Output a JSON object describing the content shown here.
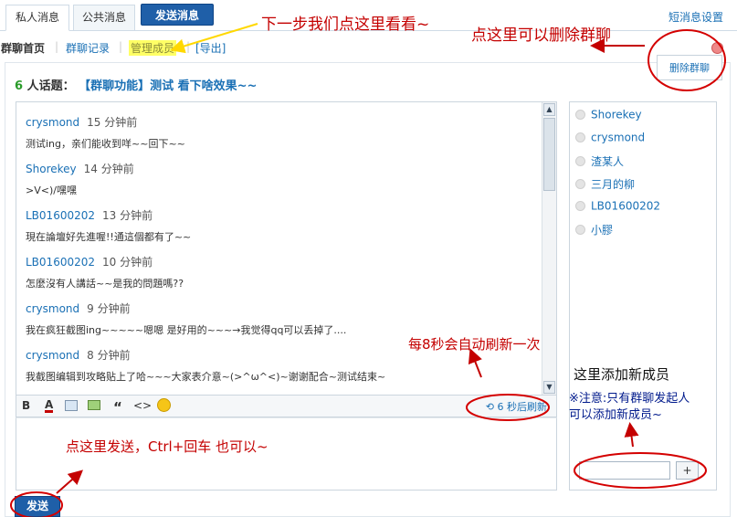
{
  "tabs": {
    "private": "私人消息",
    "public": "公共消息",
    "send": "发送消息"
  },
  "settings_link": "短消息设置",
  "subnav": {
    "home": "群聊首页",
    "records": "群聊记录",
    "manage": "管理成员",
    "export": "[导出]"
  },
  "chat_title": {
    "count": "6",
    "prefix": "人话题：",
    "topic": "【群聊功能】测试 看下啥效果~~"
  },
  "messages": [
    {
      "name": "crysmond",
      "time": "15 分钟前",
      "text": "测试ing，亲们能收到咩~~回下~~"
    },
    {
      "name": "Shorekey",
      "time": "14 分钟前",
      "text": ">V<)/嘿嘿"
    },
    {
      "name": "LB01600202",
      "time": "13 分钟前",
      "text": "現在論壇好先進喔!!通這個都有了~~"
    },
    {
      "name": "LB01600202",
      "time": "10 分钟前",
      "text": "怎麼沒有人講話~~是我的問題嗎??"
    },
    {
      "name": "crysmond",
      "time": "9 分钟前",
      "text": "我在疯狂截图ing~~~~~嗯嗯 是好用的~~~→我觉得qq可以丢掉了...."
    },
    {
      "name": "crysmond",
      "time": "8 分钟前",
      "text": "我截图编辑到攻略贴上了哈~~~大家表介意~(>^ω^<)~谢谢配合~测试结束~"
    }
  ],
  "refresh_text": "6 秒后刷新",
  "send_button": "发送",
  "members": [
    "Shorekey",
    "crysmond",
    "渣某人",
    "三月的柳",
    "LB01600202",
    "小膠"
  ],
  "add_member_button": "+",
  "delete_chat_popup": "删除群聊",
  "annotations": {
    "next_step": "下一步我们点这里看看~",
    "delete_here": "点这里可以删除群聊",
    "auto_refresh": "每8秒会自动刷新一次",
    "add_member": "这里添加新成员",
    "note_line1": "※注意:只有群聊发起人",
    "note_line2": "可以添加新成员~",
    "send_hint": "点这里发送，Ctrl+回车 也可以~"
  },
  "colors": {
    "accent_blue": "#1f5fa8",
    "link_blue": "#1a70b5",
    "annotation_red": "#c40000",
    "highlight_yellow": "#ffff66"
  }
}
